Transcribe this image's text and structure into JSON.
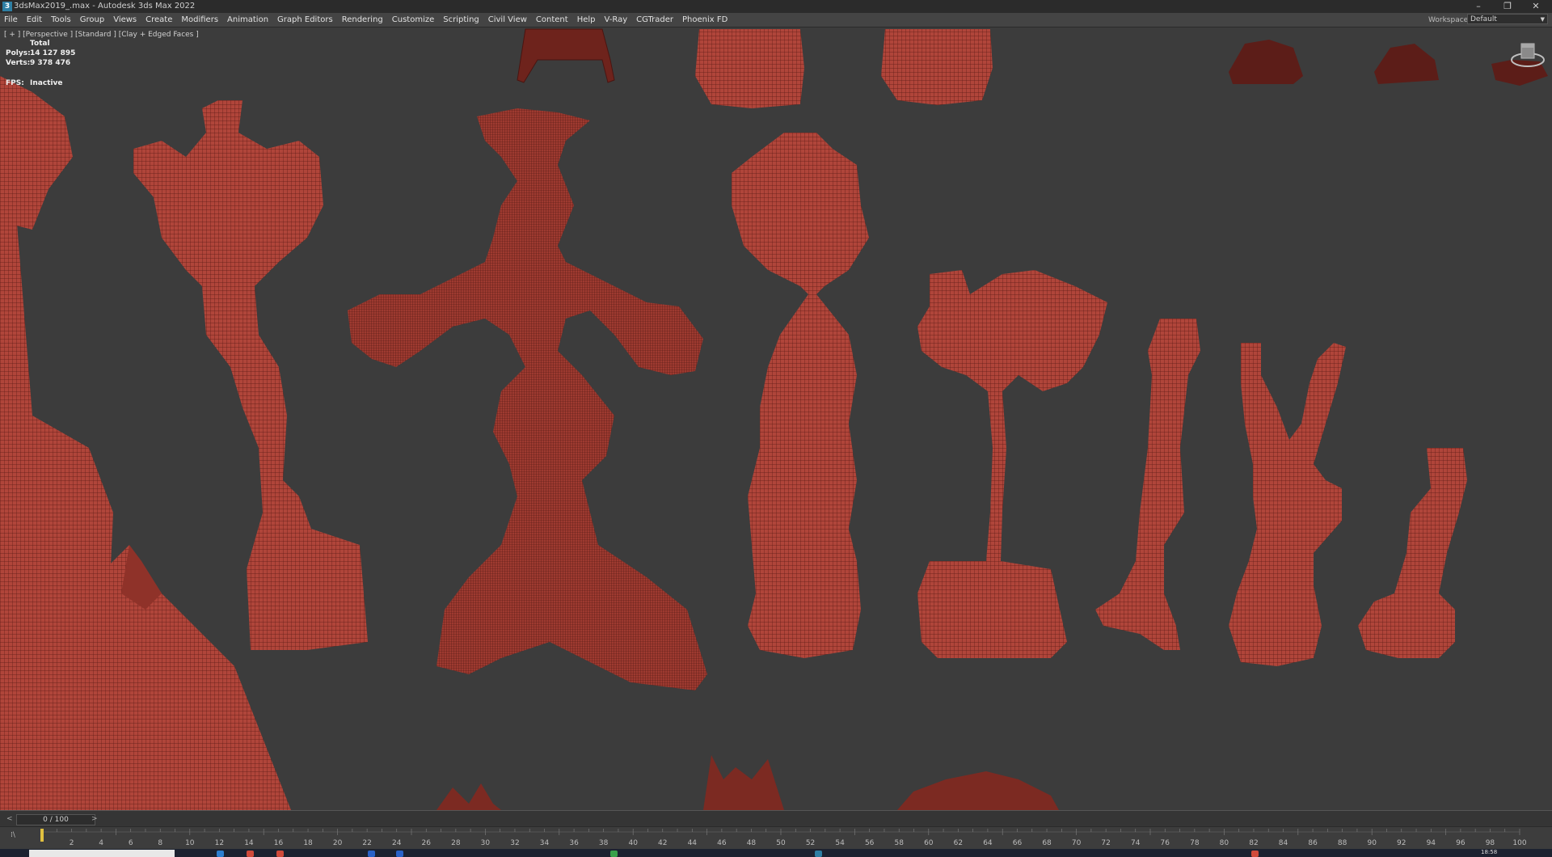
{
  "window": {
    "app_icon": "3",
    "title": "3dsMax2019_.max - Autodesk 3ds Max 2022",
    "minimize": "–",
    "restore": "❐",
    "close": "✕"
  },
  "menu": [
    "File",
    "Edit",
    "Tools",
    "Group",
    "Views",
    "Create",
    "Modifiers",
    "Animation",
    "Graph Editors",
    "Rendering",
    "Customize",
    "Scripting",
    "Civil View",
    "Content",
    "Help",
    "V-Ray",
    "CGTrader",
    "Phoenix FD"
  ],
  "workspaces": {
    "label": "Workspaces:",
    "value": "Default"
  },
  "viewport": {
    "label": "[ + ] [Perspective ] [Standard ] [Clay + Edged Faces ]",
    "stats": {
      "total_label": "Total",
      "polys_label": "Polys:",
      "polys_value": "14 127 895",
      "verts_label": "Verts:",
      "verts_value": "9 378 476"
    },
    "fps_label": "FPS:",
    "fps_value": "Inactive"
  },
  "timeslider": {
    "value": "0 / 100",
    "prev": "<",
    "next": ">"
  },
  "trackbar": {
    "icon_label": "⁞\\",
    "ticks": [
      "2",
      "4",
      "6",
      "8",
      "10",
      "12",
      "14",
      "16",
      "18",
      "20",
      "22",
      "24",
      "26",
      "28",
      "30",
      "32",
      "34",
      "36",
      "38",
      "40",
      "42",
      "44",
      "46",
      "48",
      "50",
      "52",
      "54",
      "56",
      "58",
      "60",
      "62",
      "64",
      "66",
      "68",
      "70",
      "72",
      "74",
      "76",
      "78",
      "80",
      "82",
      "84",
      "86",
      "88",
      "90",
      "92",
      "94",
      "96",
      "98",
      "100"
    ]
  },
  "taskbar": {
    "clock": "18:58"
  },
  "colors": {
    "clay": "#b0453a",
    "clay_dark": "#6e231c",
    "wire": "#4a1511",
    "viewport_bg": "#3c3c3c"
  }
}
